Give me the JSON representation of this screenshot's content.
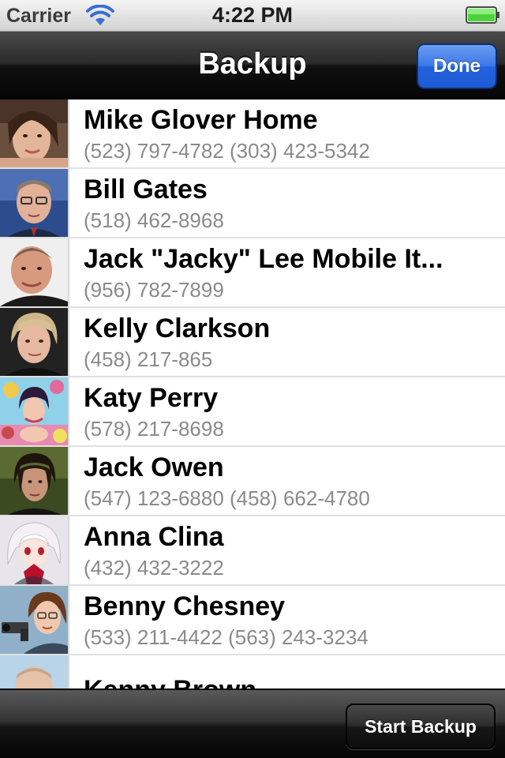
{
  "status_bar": {
    "carrier": "Carrier",
    "time": "4:22 PM"
  },
  "nav_bar": {
    "title": "Backup",
    "done_label": "Done"
  },
  "contacts": [
    {
      "name": "Mike Glover Home",
      "phone": "(523) 797-4782 (303) 423-5342"
    },
    {
      "name": "Bill Gates",
      "phone": "(518) 462-8968"
    },
    {
      "name": "Jack \"Jacky\" Lee Mobile It...",
      "phone": "(956) 782-7899"
    },
    {
      "name": "Kelly Clarkson",
      "phone": "(458) 217-865"
    },
    {
      "name": "Katy Perry",
      "phone": "(578) 217-8698"
    },
    {
      "name": "Jack Owen",
      "phone": "(547) 123-6880 (458) 662-4780"
    },
    {
      "name": "Anna Clina",
      "phone": "(432) 432-3222"
    },
    {
      "name": "Benny Chesney",
      "phone": "(533) 211-4422 (563) 243-3234"
    },
    {
      "name": "Kenny Brown",
      "phone": ""
    }
  ],
  "toolbar": {
    "start_backup_label": "Start Backup"
  },
  "colors": {
    "accent_blue": "#2d6be4",
    "phone_gray": "#8a8a8a",
    "battery_green": "#4cd33a"
  }
}
